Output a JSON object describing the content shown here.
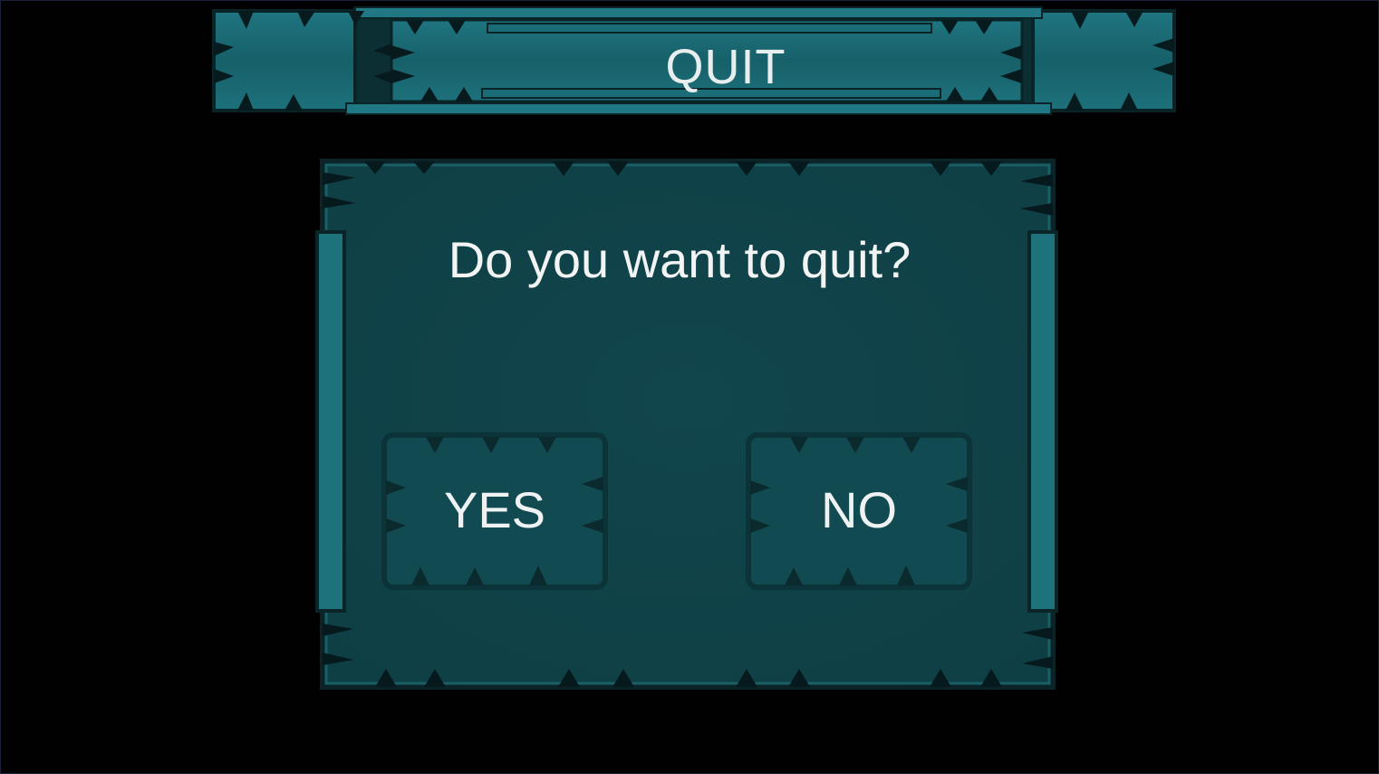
{
  "dialog": {
    "title": "QUIT",
    "prompt": "Do you want to quit?",
    "yes_label": "YES",
    "no_label": "NO"
  },
  "colors": {
    "background": "#000000",
    "panel": "#0f464c",
    "panel_border": "#1c6e76",
    "banner": "#1a6670",
    "text": "#f0f4f4"
  },
  "icons": {
    "decor": "spike-frame-ornament"
  }
}
